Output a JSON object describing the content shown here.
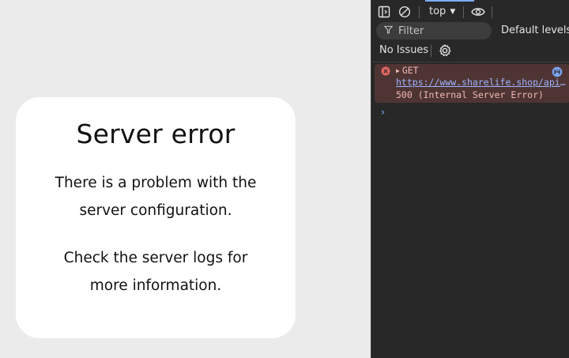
{
  "page": {
    "title": "Server error",
    "paragraph1_line1": "There is a problem with the",
    "paragraph1_line2": "server configuration.",
    "paragraph2_line1": "Check the server logs for",
    "paragraph2_line2": "more information."
  },
  "devtools": {
    "context": "top",
    "filter_placeholder": "Filter",
    "levels_label": "Default levels",
    "issues_label": "No Issues",
    "console": {
      "method": "GET",
      "url": "https://www.sharelife.shop/api/a…",
      "status": "500 (Internal Server Error)",
      "prompt": "›"
    },
    "colors": {
      "panel_bg": "#282828",
      "error_row_bg": "#4e3534",
      "error_text": "#f2b8b5",
      "link": "#9fb5ff",
      "accent": "#7cacf8"
    },
    "icons": [
      "dock-sidebar-icon",
      "clear-console-icon",
      "eye-icon",
      "filter-icon",
      "gear-icon",
      "error-icon",
      "network-link-icon"
    ]
  }
}
